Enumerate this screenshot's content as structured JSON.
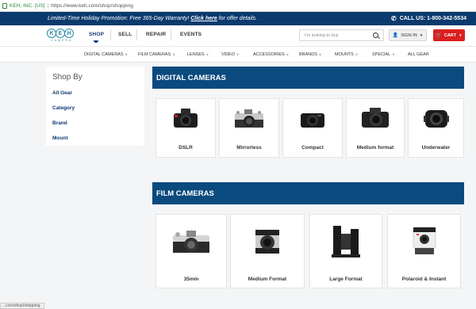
{
  "browser": {
    "site_name": "KEH, INC. [US]",
    "url": "https://www.keh.com/shop/shopping"
  },
  "promo": {
    "message_prefix": "Limited-Time Holiday Promotion: Free 365-Day Warranty! ",
    "link": "Click here",
    "message_suffix": " for offer details.",
    "call_label": "CALL US: 1-800-342-5534"
  },
  "header": {
    "logo_text": [
      "K",
      "E",
      "H"
    ],
    "logo_sub": "CAMERA",
    "nav": [
      "SHOP",
      "SELL",
      "REPAIR",
      "EVENTS"
    ],
    "search_placeholder": "I'm looking to buy",
    "signin_label": "SIGN IN",
    "cart_label": "CART"
  },
  "categories": [
    "DIGITAL CAMERAS",
    "FILM CAMERAS",
    "LENSES",
    "VIDEO",
    "ACCESSORIES",
    "BRANDS",
    "MOUNTS",
    "SPECIAL",
    "ALL GEAR"
  ],
  "sidebar": {
    "title": "Shop By",
    "items": [
      "All Gear",
      "Category",
      "Brand",
      "Mount"
    ]
  },
  "digital": {
    "heading": "DIGITAL CAMERAS",
    "items": [
      "DSLR",
      "Mirrorless",
      "Compact",
      "Medium format",
      "Underwater"
    ]
  },
  "film": {
    "heading": "FILM CAMERAS",
    "items": [
      "35mm",
      "Medium Format",
      "Large Format",
      "Polaroid & Instant"
    ]
  },
  "status_bar": "...com/shop/shopping"
}
